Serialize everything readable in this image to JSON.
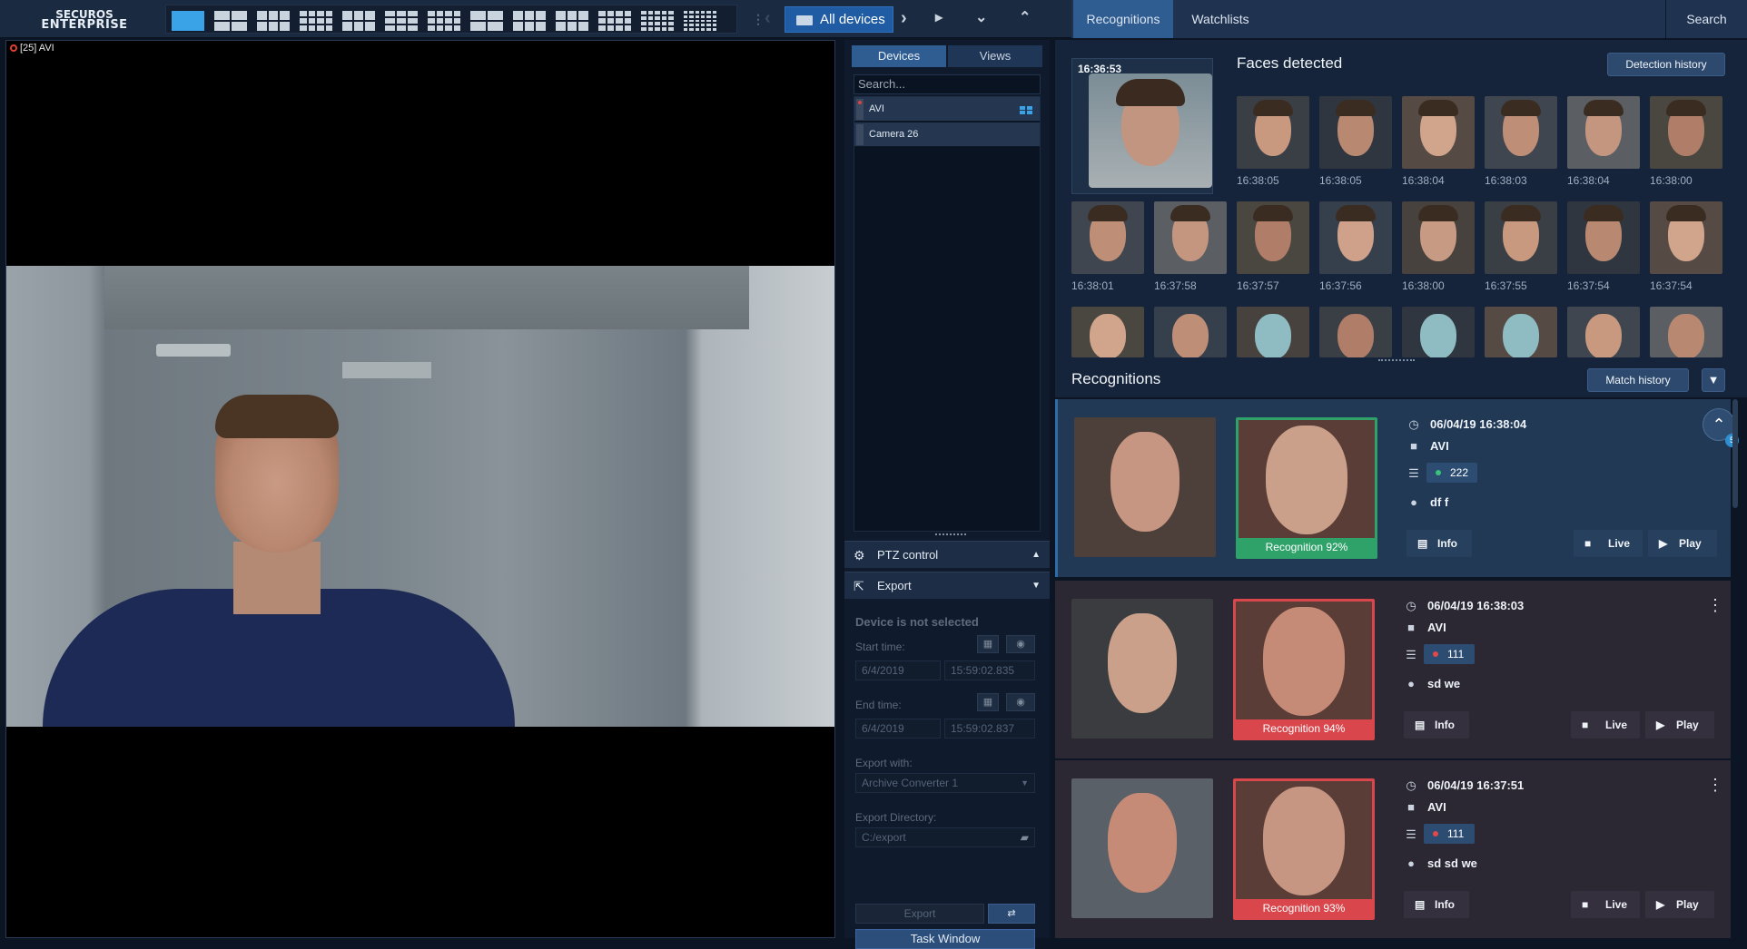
{
  "app": {
    "logo_line1": "SECUROS",
    "logo_line2": "ENTERPRISE"
  },
  "toolbar": {
    "device_filter": "All devices"
  },
  "right_tabs": {
    "recognitions": "Recognitions",
    "watchlists": "Watchlists",
    "search": "Search"
  },
  "video": {
    "camera_label": "[25] AVI"
  },
  "device_panel": {
    "tab_devices": "Devices",
    "tab_views": "Views",
    "search_placeholder": "Search...",
    "devices": [
      {
        "name": "AVI"
      },
      {
        "name": "Camera 26"
      }
    ]
  },
  "ptz": {
    "label": "PTZ control"
  },
  "export": {
    "label": "Export",
    "status": "Device is not selected",
    "start_label": "Start time:",
    "start_date": "6/4/2019",
    "start_time": "15:59:02.835",
    "end_label": "End time:",
    "end_date": "6/4/2019",
    "end_time": "15:59:02.837",
    "export_with_label": "Export with:",
    "export_with": "Archive Converter 1",
    "directory_label": "Export Directory:",
    "directory": "C:/export",
    "export_button": "Export",
    "task_button": "Task Window"
  },
  "faces": {
    "title": "Faces detected",
    "history_button": "Detection history",
    "big_time": "16:36:53",
    "row1": [
      "16:38:05",
      "16:38:05",
      "16:38:04",
      "16:38:03",
      "16:38:04",
      "16:38:00"
    ],
    "row2": [
      "16:38:01",
      "16:37:58",
      "16:37:57",
      "16:37:56",
      "16:38:00",
      "16:37:55",
      "16:37:54",
      "16:37:54"
    ]
  },
  "recognitions": {
    "title": "Recognitions",
    "match_button": "Match history",
    "up_count": "5",
    "info_label": "Info",
    "live_label": "Live",
    "play_label": "Play",
    "cards": [
      {
        "datetime": "06/04/19 16:38:04",
        "camera": "AVI",
        "list_id": "222",
        "list_color": "#37c47a",
        "person": "df f",
        "match": "Recognition 92%",
        "match_color": "#2fa26a"
      },
      {
        "datetime": "06/04/19 16:38:03",
        "camera": "AVI",
        "list_id": "111",
        "list_color": "#e04a4a",
        "person": "sd we",
        "match": "Recognition 94%",
        "match_color": "#d9474c"
      },
      {
        "datetime": "06/04/19 16:37:51",
        "camera": "AVI",
        "list_id": "111",
        "list_color": "#e04a4a",
        "person": "sd sd we",
        "match": "Recognition 93%",
        "match_color": "#d9474c"
      }
    ]
  }
}
